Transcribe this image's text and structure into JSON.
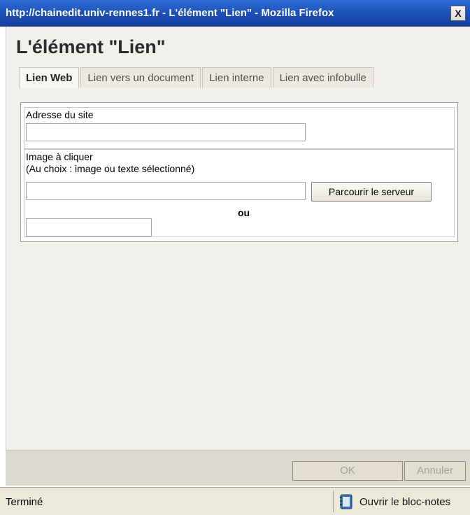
{
  "window": {
    "title": "http://chainedit.univ-rennes1.fr - L'élément \"Lien\" - Mozilla Firefox",
    "close_label": "X"
  },
  "dialog": {
    "title": "L'élément \"Lien\""
  },
  "tabs": [
    {
      "label": "Lien Web",
      "active": true
    },
    {
      "label": "Lien vers un document",
      "active": false
    },
    {
      "label": "Lien interne",
      "active": false
    },
    {
      "label": "Lien avec infobulle",
      "active": false
    }
  ],
  "form": {
    "site_label": "Adresse du site",
    "site_value": "",
    "image_label": "Image à cliquer",
    "image_hint": "(Au choix : image ou texte sélectionné)",
    "image_value": "",
    "browse_label": "Parcourir le serveur",
    "or_label": "ou",
    "text_value": ""
  },
  "footer": {
    "ok_label": "OK",
    "cancel_label": "Annuler"
  },
  "status": {
    "text": "Terminé",
    "notes_label": "Ouvrir le bloc-notes"
  },
  "colors": {
    "titlebar": "#1d4fb8",
    "panel_bg": "#f1f0ec",
    "footer_bg": "#dcd9cf",
    "statusbar_bg": "#ece9d8"
  }
}
